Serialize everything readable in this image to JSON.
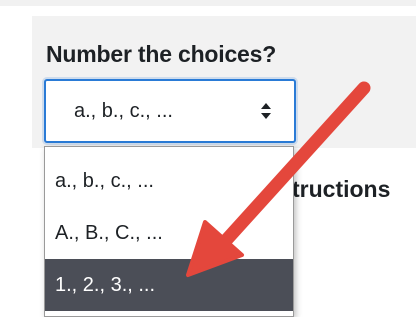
{
  "form": {
    "label": "Number the choices?",
    "select": {
      "value": "a., b., c., ...",
      "options": [
        "a., b., c., ...",
        "A., B., C., ...",
        "1., 2., 3., ..."
      ],
      "highlighted_index": 2
    },
    "partial_text": "tructions"
  },
  "annotation": {
    "icon": "arrow-icon",
    "color": "#e4473c"
  },
  "colors": {
    "focus_border": "#2a7bd6",
    "highlight_bg": "#4b4e57",
    "panel_bg": "#f2f2f2"
  }
}
